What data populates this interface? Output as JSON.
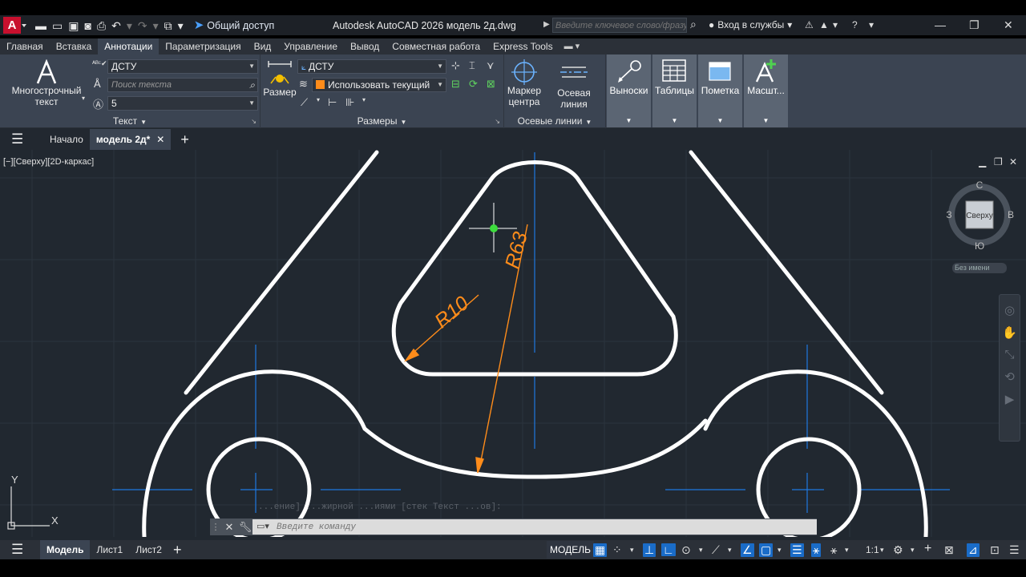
{
  "titlebar": {
    "logo": "A",
    "share_label": "Общий доступ",
    "app_title": "Autodesk AutoCAD 2026   модель 2д.dwg",
    "search_placeholder": "Введите ключевое слово/фразу",
    "login_label": "Вход в службы"
  },
  "ribbon_tabs": [
    "Главная",
    "Вставка",
    "Аннотации",
    "Параметризация",
    "Вид",
    "Управление",
    "Вывод",
    "Совместная работа",
    "Express Tools"
  ],
  "ribbon_tab_active": 2,
  "ribbon": {
    "text_panel": {
      "title": "Текст",
      "mtext_label": "Многострочный текст",
      "style_value": "ДСТУ",
      "find_placeholder": "Поиск текста",
      "height_value": "5"
    },
    "dims_panel": {
      "title": "Размеры",
      "dim_label": "Размер",
      "dimstyle_value": "ДСТУ",
      "layer_value": "Использовать текущий"
    },
    "center_panel": {
      "title": "Осевые линии",
      "center_mark_label": "Маркер центра",
      "centerline_label": "Осевая линия"
    },
    "big_buttons": [
      {
        "label": "Выноски"
      },
      {
        "label": "Таблицы"
      },
      {
        "label": "Пометка"
      },
      {
        "label": "Масшт..."
      }
    ]
  },
  "file_tabs": {
    "start": "Начало",
    "current": "модель 2д*"
  },
  "viewport": {
    "label": "[−][Сверху][2D-каркас]",
    "viewcube": {
      "face": "Сверху",
      "north": "С",
      "south": "Ю",
      "east": "В",
      "west": "З"
    },
    "ucs_name": "Без имени",
    "dimension_labels": [
      "R10",
      "R63"
    ],
    "ucs_axis_y": "Y",
    "ucs_axis_x": "X"
  },
  "command_line": {
    "placeholder": "Введите команду",
    "ghost_text": "...ение]  ...жирной  ...иями  [стек  Текст  ...ов]:"
  },
  "status_bar": {
    "tabs": [
      "Модель",
      "Лист1",
      "Лист2"
    ],
    "model_button": "МОДЕЛЬ",
    "scale": "1:1"
  },
  "colors": {
    "accent_blue": "#1a6cc8",
    "dimension_orange": "#ff8c1a",
    "centerline_blue": "#1e78e0",
    "background": "#212830"
  }
}
